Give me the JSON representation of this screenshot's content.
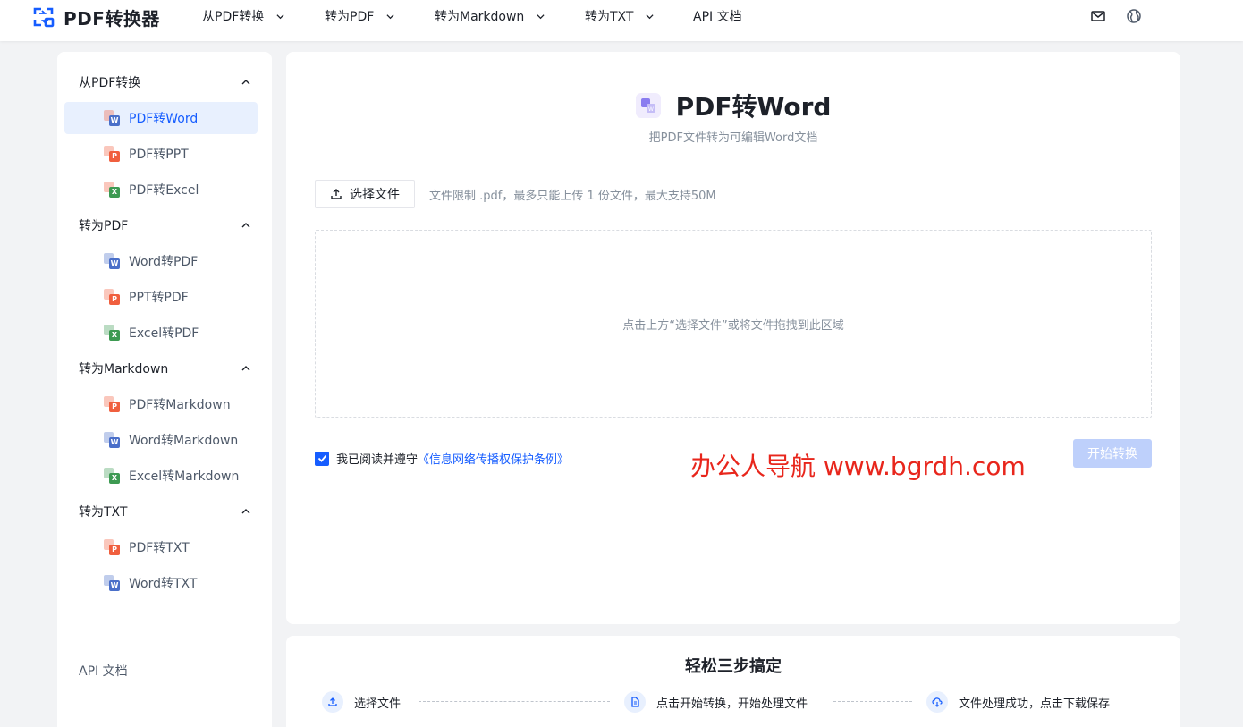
{
  "header": {
    "app_name": "PDF转换器",
    "nav": [
      {
        "label": "从PDF转换",
        "has_dropdown": true
      },
      {
        "label": "转为PDF",
        "has_dropdown": true
      },
      {
        "label": "转为Markdown",
        "has_dropdown": true
      },
      {
        "label": "转为TXT",
        "has_dropdown": true
      },
      {
        "label": "API 文档",
        "has_dropdown": false
      }
    ],
    "icons": [
      "mail-icon",
      "globe-icon"
    ]
  },
  "sidebar": {
    "groups": [
      {
        "label": "从PDF转换",
        "items": [
          {
            "label": "PDF转Word",
            "icon": "pdf-to-word-icon",
            "active": true
          },
          {
            "label": "PDF转PPT",
            "icon": "pdf-to-ppt-icon"
          },
          {
            "label": "PDF转Excel",
            "icon": "pdf-to-excel-icon"
          }
        ]
      },
      {
        "label": "转为PDF",
        "items": [
          {
            "label": "Word转PDF",
            "icon": "word-to-pdf-icon"
          },
          {
            "label": "PPT转PDF",
            "icon": "ppt-to-pdf-icon"
          },
          {
            "label": "Excel转PDF",
            "icon": "excel-to-pdf-icon"
          }
        ]
      },
      {
        "label": "转为Markdown",
        "items": [
          {
            "label": "PDF转Markdown",
            "icon": "pdf-to-markdown-icon"
          },
          {
            "label": "Word转Markdown",
            "icon": "word-to-markdown-icon"
          },
          {
            "label": "Excel转Markdown",
            "icon": "excel-to-markdown-icon"
          }
        ]
      },
      {
        "label": "转为TXT",
        "items": [
          {
            "label": "PDF转TXT",
            "icon": "pdf-to-txt-icon"
          },
          {
            "label": "Word转TXT",
            "icon": "word-to-txt-icon"
          }
        ]
      }
    ],
    "api_link": "API 文档"
  },
  "main": {
    "title": "PDF转Word",
    "subtitle": "把PDF文件转为可编辑Word文档",
    "select_button": "选择文件",
    "limit_text": "文件限制 .pdf，最多只能上传 1 份文件，最大支持50M",
    "drop_text": "点击上方“选择文件”或将文件拖拽到此区域",
    "agree_checked": true,
    "agree_text": "我已阅读并遵守",
    "agree_link": "《信息网络传播权保护条例》",
    "start_button": "开始转换",
    "start_disabled": true
  },
  "watermark": "办公人导航 www.bgrdh.com",
  "steps": {
    "title": "轻松三步搞定",
    "items": [
      {
        "label": "选择文件",
        "icon": "upload-icon"
      },
      {
        "label": "点击开始转换，开始处理文件",
        "icon": "document-icon"
      },
      {
        "label": "文件处理成功，点击下载保存",
        "icon": "cloud-download-icon"
      }
    ]
  },
  "colors": {
    "accent": "#165dff",
    "accent_light": "#e8f0fe",
    "word": "#4a6fc9",
    "ppt": "#f05f3e",
    "excel": "#3d9a52",
    "watermark": "#e8261c"
  }
}
